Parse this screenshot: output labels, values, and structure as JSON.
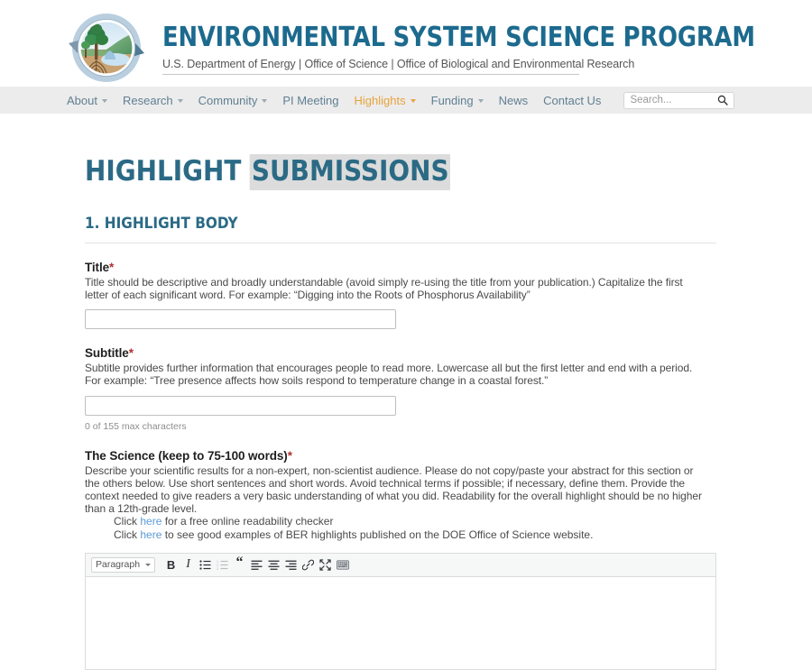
{
  "header": {
    "logo_alt": "ess-program-logo",
    "title": "ENVIRONMENTAL SYSTEM SCIENCE PROGRAM",
    "subtitle": "U.S. Department of Energy | Office of Science | Office of Biological and Environmental Research"
  },
  "nav": {
    "items": [
      {
        "label": "About",
        "has_caret": true,
        "active": false
      },
      {
        "label": "Research",
        "has_caret": true,
        "active": false
      },
      {
        "label": "Community",
        "has_caret": true,
        "active": false
      },
      {
        "label": "PI Meeting",
        "has_caret": false,
        "active": false
      },
      {
        "label": "Highlights",
        "has_caret": true,
        "active": true
      },
      {
        "label": "Funding",
        "has_caret": true,
        "active": false
      },
      {
        "label": "News",
        "has_caret": false,
        "active": false
      },
      {
        "label": "Contact Us",
        "has_caret": false,
        "active": false
      }
    ],
    "search": {
      "value": "",
      "placeholder": "Search...",
      "icon": "search-icon"
    },
    "active_color": "#e7a33c",
    "link_color": "#5f7f92",
    "background": "#ececec"
  },
  "page": {
    "title_part1": "HIGHLIGHT ",
    "title_part2": "SUBMISSIONS",
    "title_color": "#2b6a85",
    "selection_background": "#dcdcdc",
    "section_title": "1. HIGHLIGHT BODY"
  },
  "fields": {
    "title": {
      "label": "Title",
      "required_marker": "*",
      "help": "Title should be descriptive and broadly understandable (avoid simply re-using the title from your publication.) Capitalize the first letter of each significant word. For example: “Digging into the Roots of Phosphorus Availability”",
      "value": "",
      "placeholder": ""
    },
    "subtitle": {
      "label": "Subtitle",
      "required_marker": "*",
      "help": "Subtitle provides further information that encourages people to read more. Lowercase all but the first letter and end with a period. For example: “Tree presence affects how soils respond to temperature change in a coastal forest.”",
      "value": "",
      "placeholder": "",
      "char_count": "0 of 155 max characters"
    },
    "science": {
      "label": "The Science (keep to 75-100 words)",
      "required_marker": "*",
      "help": "Describe your scientific results for a non-expert, non-scientist audience. Please do not copy/paste your abstract for this section or the others below. Use short sentences and short words. Avoid technical terms if possible; if necessary, define them. Provide the context needed to give readers a very basic understanding of what you did. Readability for the overall highlight should be no higher than a 12th-grade level.",
      "link_line_1_pre": "Click ",
      "link_line_1_link": "here",
      "link_line_1_post": " for a free online readability checker",
      "link_line_2_pre": "Click ",
      "link_line_2_link": "here",
      "link_line_2_post": " to see good examples of BER highlights published on the DOE Office of Science website.",
      "link_color": "#5b9bd5"
    }
  },
  "editor": {
    "format_select": "Paragraph",
    "buttons": [
      {
        "name": "bold-icon",
        "label": "B",
        "disabled": false
      },
      {
        "name": "italic-icon",
        "label": "I",
        "disabled": false
      },
      {
        "name": "bulleted-list-icon",
        "label": "",
        "disabled": false
      },
      {
        "name": "numbered-list-icon",
        "label": "",
        "disabled": true
      },
      {
        "name": "blockquote-icon",
        "label": "“",
        "disabled": false
      },
      {
        "name": "align-left-icon",
        "label": "",
        "disabled": false
      },
      {
        "name": "align-center-icon",
        "label": "",
        "disabled": false
      },
      {
        "name": "align-right-icon",
        "label": "",
        "disabled": false
      },
      {
        "name": "link-icon",
        "label": "",
        "disabled": false
      },
      {
        "name": "fullscreen-icon",
        "label": "",
        "disabled": false
      },
      {
        "name": "keyboard-shortcuts-icon",
        "label": "",
        "disabled": false
      }
    ],
    "content": ""
  }
}
